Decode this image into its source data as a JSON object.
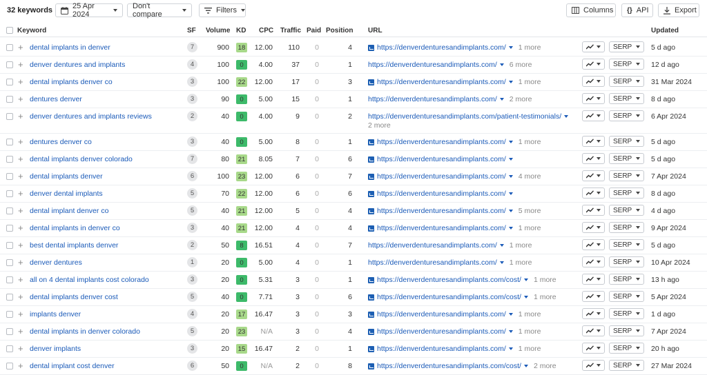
{
  "toolbar": {
    "keyword_count": "32 keywords",
    "date": "25 Apr 2024",
    "compare": "Don't compare",
    "filters": "Filters",
    "columns": "Columns",
    "api": "API",
    "export": "Export"
  },
  "columns": {
    "keyword": "Keyword",
    "sf": "SF",
    "volume": "Volume",
    "kd": "KD",
    "cpc": "CPC",
    "traffic": "Traffic",
    "paid": "Paid",
    "position": "Position",
    "url": "URL",
    "updated": "Updated"
  },
  "trend_label": "",
  "serp_label": "SERP",
  "kd_colors": {
    "green": "#3dba6a",
    "lightgreen": "#a8d98a"
  },
  "rows": [
    {
      "keyword": "dental implants in denver",
      "sf": "7",
      "volume": "900",
      "kd": "18",
      "cpc": "12.00",
      "traffic": "110",
      "paid": "0",
      "position": "4",
      "url": "https://denverdenturesandimplants.com/",
      "favicon": true,
      "more": "1 more",
      "updated": "5 d ago"
    },
    {
      "keyword": "denver dentures and implants",
      "sf": "4",
      "volume": "100",
      "kd": "0",
      "cpc": "4.00",
      "traffic": "37",
      "paid": "0",
      "position": "1",
      "url": "https://denverdenturesandimplants.com/",
      "favicon": false,
      "more": "6 more",
      "updated": "12 d ago"
    },
    {
      "keyword": "dental implants denver co",
      "sf": "3",
      "volume": "100",
      "kd": "22",
      "cpc": "12.00",
      "traffic": "17",
      "paid": "0",
      "position": "3",
      "url": "https://denverdenturesandimplants.com/",
      "favicon": true,
      "more": "1 more",
      "updated": "31 Mar 2024"
    },
    {
      "keyword": "dentures denver",
      "sf": "3",
      "volume": "90",
      "kd": "0",
      "cpc": "5.00",
      "traffic": "15",
      "paid": "0",
      "position": "1",
      "url": "https://denverdenturesandimplants.com/",
      "favicon": false,
      "more": "2 more",
      "updated": "8 d ago"
    },
    {
      "keyword": "denver dentures and implants reviews",
      "sf": "2",
      "volume": "40",
      "kd": "0",
      "cpc": "4.00",
      "traffic": "9",
      "paid": "0",
      "position": "2",
      "url": "https://denverdenturesandimplants.com/patient-testimonials/",
      "favicon": false,
      "more": "2 more",
      "more_wrap": true,
      "updated": "6 Apr 2024"
    },
    {
      "keyword": "dentures denver co",
      "sf": "3",
      "volume": "40",
      "kd": "0",
      "cpc": "5.00",
      "traffic": "8",
      "paid": "0",
      "position": "1",
      "url": "https://denverdenturesandimplants.com/",
      "favicon": true,
      "more": "1 more",
      "updated": "5 d ago"
    },
    {
      "keyword": "dental implants denver colorado",
      "sf": "7",
      "volume": "80",
      "kd": "21",
      "cpc": "8.05",
      "traffic": "7",
      "paid": "0",
      "position": "6",
      "url": "https://denverdenturesandimplants.com/",
      "favicon": true,
      "more": "",
      "updated": "5 d ago"
    },
    {
      "keyword": "dental implants denver",
      "sf": "6",
      "volume": "100",
      "kd": "23",
      "cpc": "12.00",
      "traffic": "6",
      "paid": "0",
      "position": "7",
      "url": "https://denverdenturesandimplants.com/",
      "favicon": true,
      "more": "4 more",
      "updated": "7 Apr 2024"
    },
    {
      "keyword": "denver dental implants",
      "sf": "5",
      "volume": "70",
      "kd": "22",
      "cpc": "12.00",
      "traffic": "6",
      "paid": "0",
      "position": "6",
      "url": "https://denverdenturesandimplants.com/",
      "favicon": true,
      "more": "",
      "updated": "8 d ago"
    },
    {
      "keyword": "dental implant denver co",
      "sf": "5",
      "volume": "40",
      "kd": "21",
      "cpc": "12.00",
      "traffic": "5",
      "paid": "0",
      "position": "4",
      "url": "https://denverdenturesandimplants.com/",
      "favicon": true,
      "more": "5 more",
      "updated": "4 d ago"
    },
    {
      "keyword": "dental implants in denver co",
      "sf": "3",
      "volume": "40",
      "kd": "21",
      "cpc": "12.00",
      "traffic": "4",
      "paid": "0",
      "position": "4",
      "url": "https://denverdenturesandimplants.com/",
      "favicon": true,
      "more": "1 more",
      "updated": "9 Apr 2024"
    },
    {
      "keyword": "best dental implants denver",
      "sf": "2",
      "volume": "50",
      "kd": "8",
      "cpc": "16.51",
      "traffic": "4",
      "paid": "0",
      "position": "7",
      "url": "https://denverdenturesandimplants.com/",
      "favicon": false,
      "more": "1 more",
      "updated": "5 d ago"
    },
    {
      "keyword": "denver dentures",
      "sf": "1",
      "volume": "20",
      "kd": "0",
      "cpc": "5.00",
      "traffic": "4",
      "paid": "0",
      "position": "1",
      "url": "https://denverdenturesandimplants.com/",
      "favicon": false,
      "more": "1 more",
      "updated": "10 Apr 2024"
    },
    {
      "keyword": "all on 4 dental implants cost colorado",
      "sf": "3",
      "volume": "20",
      "kd": "0",
      "cpc": "5.31",
      "traffic": "3",
      "paid": "0",
      "position": "1",
      "url": "https://denverdenturesandimplants.com/cost/",
      "favicon": true,
      "more": "1 more",
      "updated": "13 h ago"
    },
    {
      "keyword": "dental implants denver cost",
      "sf": "5",
      "volume": "40",
      "kd": "0",
      "cpc": "7.71",
      "traffic": "3",
      "paid": "0",
      "position": "6",
      "url": "https://denverdenturesandimplants.com/cost/",
      "favicon": true,
      "more": "1 more",
      "updated": "5 Apr 2024"
    },
    {
      "keyword": "implants denver",
      "sf": "4",
      "volume": "20",
      "kd": "17",
      "cpc": "16.47",
      "traffic": "3",
      "paid": "0",
      "position": "3",
      "url": "https://denverdenturesandimplants.com/",
      "favicon": true,
      "more": "1 more",
      "updated": "1 d ago"
    },
    {
      "keyword": "dental implants in denver colorado",
      "sf": "5",
      "volume": "20",
      "kd": "23",
      "cpc": "N/A",
      "traffic": "3",
      "paid": "0",
      "position": "4",
      "url": "https://denverdenturesandimplants.com/",
      "favicon": true,
      "more": "1 more",
      "updated": "7 Apr 2024"
    },
    {
      "keyword": "denver implants",
      "sf": "3",
      "volume": "20",
      "kd": "15",
      "cpc": "16.47",
      "traffic": "2",
      "paid": "0",
      "position": "1",
      "url": "https://denverdenturesandimplants.com/",
      "favicon": true,
      "more": "1 more",
      "updated": "20 h ago"
    },
    {
      "keyword": "dental implant cost denver",
      "sf": "6",
      "volume": "50",
      "kd": "0",
      "cpc": "N/A",
      "traffic": "2",
      "paid": "0",
      "position": "8",
      "url": "https://denverdenturesandimplants.com/cost/",
      "favicon": true,
      "more": "2 more",
      "updated": "27 Mar 2024"
    }
  ]
}
